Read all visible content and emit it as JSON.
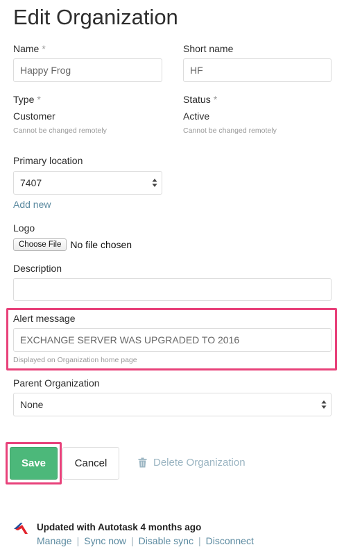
{
  "page_title": "Edit Organization",
  "form": {
    "name": {
      "label": "Name",
      "required_mark": "*",
      "value": "Happy Frog"
    },
    "short_name": {
      "label": "Short name",
      "value": "HF"
    },
    "type": {
      "label": "Type",
      "required_mark": "*",
      "value": "Customer",
      "hint": "Cannot be changed remotely"
    },
    "status": {
      "label": "Status",
      "required_mark": "*",
      "value": "Active",
      "hint": "Cannot be changed remotely"
    },
    "primary_location": {
      "label": "Primary location",
      "selected": "7407",
      "add_new": "Add new"
    },
    "logo": {
      "label": "Logo",
      "choose_file": "Choose File",
      "file_status": "No file chosen"
    },
    "description": {
      "label": "Description",
      "value": ""
    },
    "alert_message": {
      "label": "Alert message",
      "value": "EXCHANGE SERVER WAS UPGRADED TO 2016",
      "hint": "Displayed on Organization home page"
    },
    "parent_organization": {
      "label": "Parent Organization",
      "selected": "None"
    }
  },
  "actions": {
    "save": "Save",
    "cancel": "Cancel",
    "delete": "Delete Organization"
  },
  "sync": {
    "status": "Updated with Autotask 4 months ago",
    "links": [
      "Manage",
      "Sync now",
      "Disable sync",
      "Disconnect"
    ]
  },
  "colors": {
    "accent_highlight": "#e8417a",
    "save_green": "#4cb87a",
    "link_blue": "#5b8aa0",
    "autotask_red": "#e2222b",
    "autotask_blue": "#1e4d9a"
  }
}
